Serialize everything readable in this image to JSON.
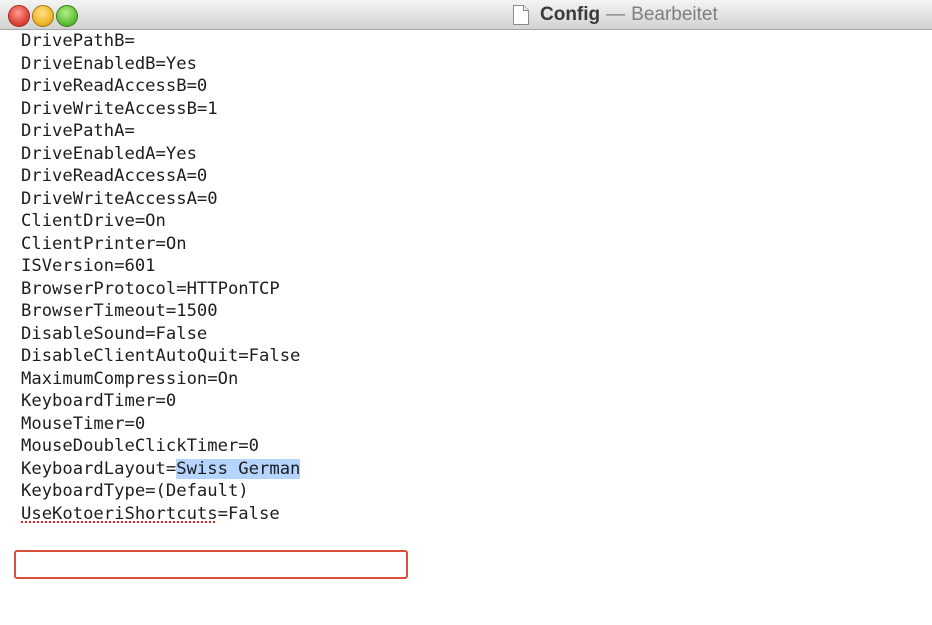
{
  "window": {
    "title": "Config",
    "separator": "—",
    "status": "Bearbeitet",
    "doc_icon": "document-icon"
  },
  "editor": {
    "lines": [
      "DrivePathB=",
      "DriveEnabledB=Yes",
      "DriveReadAccessB=0",
      "DriveWriteAccessB=1",
      "DrivePathA=",
      "DriveEnabledA=Yes",
      "DriveReadAccessA=0",
      "DriveWriteAccessA=0",
      "ClientDrive=On",
      "ClientPrinter=On",
      "ISVersion=601",
      "BrowserProtocol=HTTPonTCP",
      "BrowserTimeout=1500",
      "DisableSound=False",
      "DisableClientAutoQuit=False",
      "MaximumCompression=On",
      "KeyboardTimer=0",
      "MouseTimer=0",
      "MouseDoubleClickTimer=0"
    ],
    "highlighted": {
      "key": "KeyboardLayout=",
      "selected_value": "Swiss German"
    },
    "after": {
      "keyboard_type": "KeyboardType=(Default)",
      "kotoeri_key": "UseKotoeriShortcuts",
      "kotoeri_value": "=False"
    }
  },
  "colors": {
    "selection": "#b5d5ff",
    "highlight_border": "#d94e3c"
  }
}
